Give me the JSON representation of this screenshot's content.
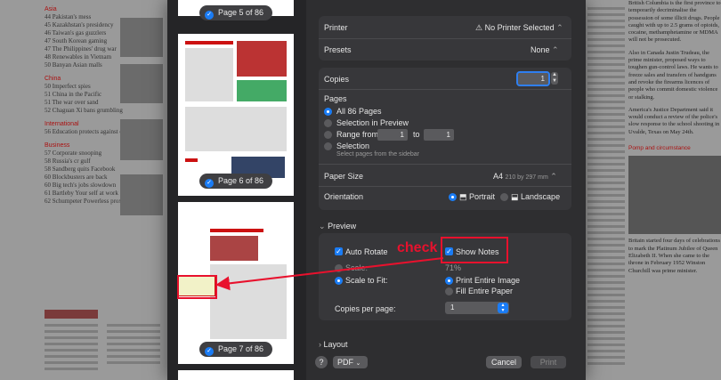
{
  "background": {
    "left_sections": [
      {
        "title": "Asia",
        "items": [
          [
            "44",
            "Pakistan's mess"
          ],
          [
            "45",
            "Kazakhstan's presidency"
          ],
          [
            "46",
            "Taiwan's gas guzzlers"
          ],
          [
            "47",
            "South Korean gaming"
          ],
          [
            "47",
            "The Philippines' drug war"
          ],
          [
            "48",
            "Renewables in Vietnam"
          ],
          [
            "50",
            "Banyan Asian malls"
          ]
        ]
      },
      {
        "title": "China",
        "items": [
          [
            "50",
            "Imperfect spies"
          ],
          [
            "51",
            "China in the Pacific"
          ],
          [
            "51",
            "The war over sand"
          ],
          [
            "52",
            "Chaguan Xi bans grumbling"
          ]
        ]
      },
      {
        "title": "International",
        "items": [
          [
            "56",
            "Education protects against climate change"
          ]
        ]
      },
      {
        "title": "Business",
        "items": [
          [
            "57",
            "Corporate snooping"
          ],
          [
            "58",
            "Russia's cr gulf"
          ],
          [
            "58",
            "Sandberg quits Facebook"
          ],
          [
            "60",
            "Blockbusters are back"
          ],
          [
            "60",
            "Big tech's jobs slowdown"
          ],
          [
            "61",
            "Bartleby Your self at work"
          ],
          [
            "62",
            "Schumpeter Powerless proxies"
          ]
        ]
      }
    ],
    "right_column": {
      "top_text": "British Columbia is the first province to temporarily decriminalise the possession of some illicit drugs. People caught with up to 2.5 grams of opioids, cocaine, methamphetamine or MDMA will not be prosecuted.",
      "mid_text": "Also in Canada Justin Trudeau, the prime minister, proposed ways to toughen gun-control laws. He wants to freeze sales and transfers of handguns and revoke the firearms licences of people who commit domestic violence or stalking.",
      "us_text": "America's Justice Department said it would conduct a review of the police's slow response to the school shooting in Uvalde, Texas on May 24th.",
      "section_title": "Pomp and circumstance",
      "bottom_text": "Britain started four days of celebrations to mark the Platinum Jubilee of Queen Elizabeth II. When she came to the throne in February 1952 Winston Churchill was prime minister."
    }
  },
  "dialog": {
    "printer": {
      "label": "Printer",
      "value": "No Printer Selected"
    },
    "presets": {
      "label": "Presets",
      "value": "None"
    },
    "copies": {
      "label": "Copies",
      "value": "1"
    },
    "pages": {
      "label": "Pages",
      "options": [
        "All 86 Pages",
        "Selection in Preview",
        "Range from",
        "Selection"
      ],
      "range_from": "1",
      "range_to_label": "to",
      "range_to": "1",
      "selection_hint": "Select pages from the sidebar"
    },
    "paper_size": {
      "label": "Paper Size",
      "value": "A4",
      "dims": "210 by 297 mm"
    },
    "orientation": {
      "label": "Orientation",
      "portrait": "Portrait",
      "landscape": "Landscape"
    },
    "preview_section": {
      "title": "Preview",
      "auto_rotate": "Auto Rotate",
      "show_notes": "Show Notes",
      "scale": "Scale:",
      "scale_value": "71%",
      "scale_to_fit": "Scale to Fit:",
      "print_entire_image": "Print Entire Image",
      "fill_entire_paper": "Fill Entire Paper",
      "copies_per_page_label": "Copies per page:",
      "copies_per_page_value": "1"
    },
    "layout_section": "Layout",
    "help": "?",
    "pdf": "PDF",
    "cancel": "Cancel",
    "print": "Print",
    "thumbnails": [
      "Page 5 of 86",
      "Page 6 of 86",
      "Page 7 of 86"
    ]
  },
  "annotation": {
    "text": "check"
  },
  "colors": {
    "accent": "#1a7cf5",
    "annotation": "#e8112d"
  }
}
